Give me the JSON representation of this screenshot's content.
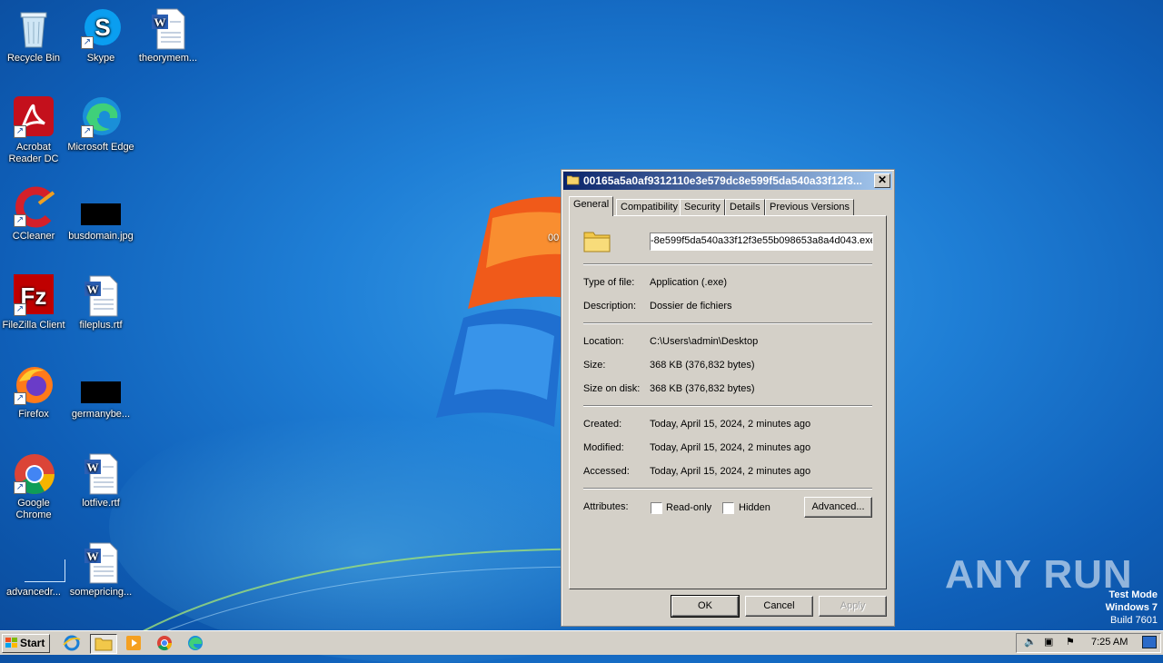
{
  "desktop": {
    "icons": [
      {
        "label": "Recycle Bin",
        "icon": "recycle-bin-icon"
      },
      {
        "label": "Skype",
        "icon": "skype-icon"
      },
      {
        "label": "theorymem...",
        "icon": "word-document-icon"
      },
      {
        "label": "Acrobat Reader DC",
        "icon": "acrobat-icon"
      },
      {
        "label": "Microsoft Edge",
        "icon": "edge-icon"
      },
      {
        "label": "CCleaner",
        "icon": "ccleaner-icon"
      },
      {
        "label": "busdomain.jpg",
        "icon": "image-file-icon"
      },
      {
        "label": "FileZilla Client",
        "icon": "filezilla-icon"
      },
      {
        "label": "fileplus.rtf",
        "icon": "word-document-icon"
      },
      {
        "label": "Firefox",
        "icon": "firefox-icon"
      },
      {
        "label": "germanybe...",
        "icon": "image-file-icon"
      },
      {
        "label": "Google Chrome",
        "icon": "chrome-icon"
      },
      {
        "label": "lotfive.rtf",
        "icon": "word-document-icon"
      },
      {
        "label": "advancedr...",
        "icon": "blank-file-icon"
      },
      {
        "label": "somepricing...",
        "icon": "word-document-icon"
      }
    ],
    "partial_text": "00"
  },
  "dialog": {
    "title": "00165a5a0af9312110e3e579dc8e599f5da540a33f12f3...",
    "tabs": [
      "General",
      "Compatibility",
      "Security",
      "Details",
      "Previous Versions"
    ],
    "active_tab": "General",
    "filename": "-8e599f5da540a33f12f3e55b098653a8a4d043.exe",
    "type_label": "Type of file:",
    "type_value": "Application (.exe)",
    "desc_label": "Description:",
    "desc_value": "Dossier de fichiers",
    "location_label": "Location:",
    "location_value": "C:\\Users\\admin\\Desktop",
    "size_label": "Size:",
    "size_value": "368 KB (376,832 bytes)",
    "sizeondisk_label": "Size on disk:",
    "sizeondisk_value": "368 KB (376,832 bytes)",
    "created_label": "Created:",
    "created_value": "Today, April 15, 2024, 2 minutes ago",
    "modified_label": "Modified:",
    "modified_value": "Today, April 15, 2024, 2 minutes ago",
    "accessed_label": "Accessed:",
    "accessed_value": "Today, April 15, 2024, 2 minutes ago",
    "attributes_label": "Attributes:",
    "readonly_label": "Read-only",
    "hidden_label": "Hidden",
    "advanced_label": "Advanced...",
    "ok_label": "OK",
    "cancel_label": "Cancel",
    "apply_label": "Apply",
    "close_glyph": "✕"
  },
  "watermark": {
    "text": "ANY RUN"
  },
  "testmode": {
    "line1": "Test Mode",
    "line2": "Windows 7",
    "line3": "Build 7601"
  },
  "taskbar": {
    "start_label": "Start",
    "clock": "7:25 AM",
    "pinned": [
      "internet-explorer-icon",
      "explorer-folder-icon",
      "media-player-icon",
      "chrome-icon",
      "edge-icon"
    ]
  },
  "colors": {
    "title_start": "#0a246a",
    "title_end": "#a6caf0",
    "dialog_bg": "#d4d0c8"
  }
}
